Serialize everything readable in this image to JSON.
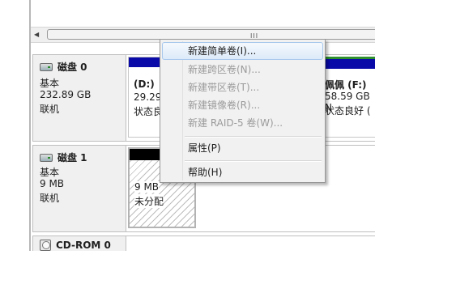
{
  "scrollbar": {
    "grip": "III"
  },
  "disks": [
    {
      "name": "磁盘 0",
      "type": "基本",
      "size": "232.89 GB",
      "status": "联机",
      "volumes": [
        {
          "label": "(D:)",
          "size": "29.29",
          "status": "状态良",
          "bar_color": "#0a0aa8"
        },
        {
          "label": "佩佩  (F:)",
          "size": "58.59 GB N",
          "status": "状态良好 (",
          "bar_color": "#0a0aa8"
        }
      ]
    },
    {
      "name": "磁盘 1",
      "type": "基本",
      "size": "9 MB",
      "status": "联机",
      "volumes": [
        {
          "label": "",
          "size": "9 MB",
          "status": "未分配",
          "bar_color": "#000000"
        }
      ]
    },
    {
      "name": "CD-ROM 0"
    }
  ],
  "context_menu": {
    "items": [
      {
        "label": "新建简单卷(I)...",
        "enabled": true,
        "highlighted": true
      },
      {
        "label": "新建跨区卷(N)...",
        "enabled": false
      },
      {
        "label": "新建带区卷(T)...",
        "enabled": false
      },
      {
        "label": "新建镜像卷(R)...",
        "enabled": false
      },
      {
        "label": "新建 RAID-5 卷(W)...",
        "enabled": false
      },
      {
        "label": "属性(P)",
        "enabled": true
      },
      {
        "label": "帮助(H)",
        "enabled": true
      }
    ]
  },
  "colors": {
    "primary_partition": "#0a0aa8",
    "unallocated": "#000000",
    "selection": "#dceaf9"
  },
  "icons": {
    "disk": "hard-disk-icon",
    "cdrom": "cd-rom-icon"
  }
}
